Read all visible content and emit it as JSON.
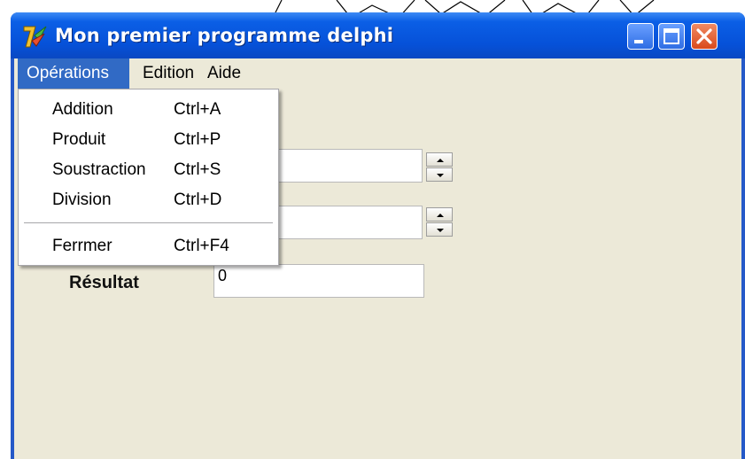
{
  "window": {
    "title": "Mon premier programme delphi",
    "controls": {
      "minimize": "minimize",
      "maximize": "maximize",
      "close": "close"
    }
  },
  "menubar": {
    "items": [
      {
        "label": "Opérations",
        "active": true
      },
      {
        "label": "Edition",
        "active": false
      },
      {
        "label": "Aide",
        "active": false
      }
    ]
  },
  "dropdown": {
    "items": [
      {
        "label": "Addition",
        "shortcut": "Ctrl+A"
      },
      {
        "label": "Produit",
        "shortcut": "Ctrl+P"
      },
      {
        "label": "Soustraction",
        "shortcut": "Ctrl+S"
      },
      {
        "label": "Division",
        "shortcut": "Ctrl+D"
      },
      {
        "label": "Ferrmer",
        "shortcut": "Ctrl+F4"
      }
    ]
  },
  "form": {
    "result_label": "Résultat",
    "result_value": "0"
  },
  "colors": {
    "titlebar": "#0651d8",
    "menu_highlight": "#316ac5",
    "client_bg": "#ece9d8",
    "close_button": "#d94a1c"
  }
}
